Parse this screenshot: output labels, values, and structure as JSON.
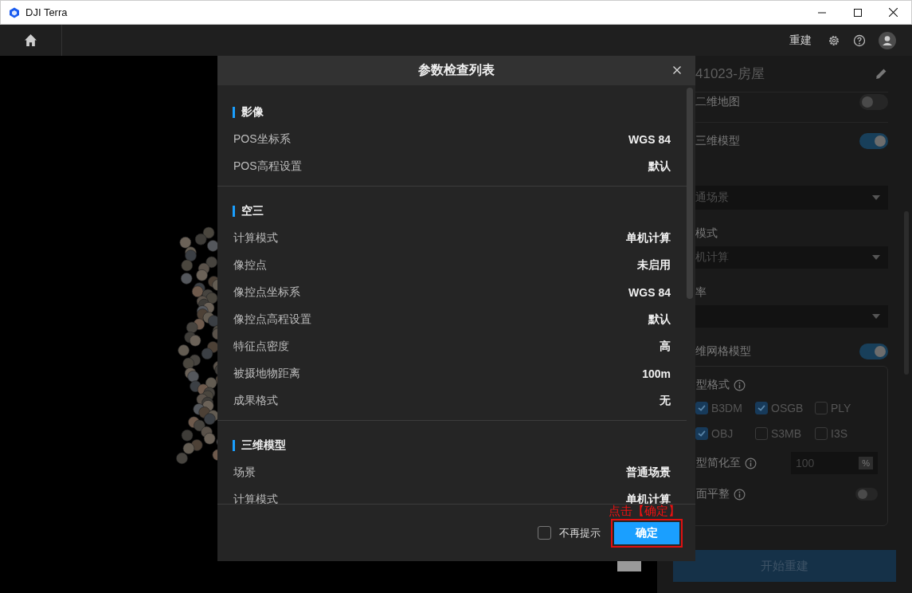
{
  "window": {
    "title": "DJI Terra"
  },
  "toolbar": {
    "action": "重建"
  },
  "panel": {
    "title": "41023-房屋",
    "outputs": [
      {
        "label": "二维地图",
        "on": false
      },
      {
        "label": "三维模型",
        "on": true
      }
    ],
    "scene_select": {
      "value": "通场景"
    },
    "mode_label": "模式",
    "mode_select": {
      "value": "机计算"
    },
    "rate_label": "率",
    "mesh": {
      "label": "维网格模型",
      "on": true,
      "format_label": "型格式",
      "formats": [
        {
          "label": "B3DM",
          "checked": true
        },
        {
          "label": "OSGB",
          "checked": true
        },
        {
          "label": "PLY",
          "checked": false
        },
        {
          "label": "OBJ",
          "checked": true
        },
        {
          "label": "S3MB",
          "checked": false
        },
        {
          "label": "I3S",
          "checked": false
        }
      ],
      "simplify_label": "型简化至",
      "simplify_value": "100",
      "simplify_unit": "%",
      "flatten_label": "面平整",
      "flatten_on": false
    },
    "start_button": "开始重建"
  },
  "dialog": {
    "title": "参数检查列表",
    "sections": [
      {
        "heading": "影像",
        "rows": [
          {
            "label": "POS坐标系",
            "value": "WGS 84"
          },
          {
            "label": "POS高程设置",
            "value": "默认"
          }
        ]
      },
      {
        "heading": "空三",
        "rows": [
          {
            "label": "计算模式",
            "value": "单机计算"
          },
          {
            "label": "像控点",
            "value": "未启用"
          },
          {
            "label": "像控点坐标系",
            "value": "WGS 84"
          },
          {
            "label": "像控点高程设置",
            "value": "默认"
          },
          {
            "label": "特征点密度",
            "value": "高"
          },
          {
            "label": "被摄地物距离",
            "value": "100m"
          },
          {
            "label": "成果格式",
            "value": "无"
          }
        ]
      },
      {
        "heading": "三维模型",
        "rows": [
          {
            "label": "场景",
            "value": "普通场景"
          },
          {
            "label": "计算模式",
            "value": "单机计算"
          }
        ]
      }
    ],
    "dont_remind": {
      "label": "不再提示",
      "checked": false
    },
    "confirm": "确定"
  },
  "annotation": "点击【确定】"
}
